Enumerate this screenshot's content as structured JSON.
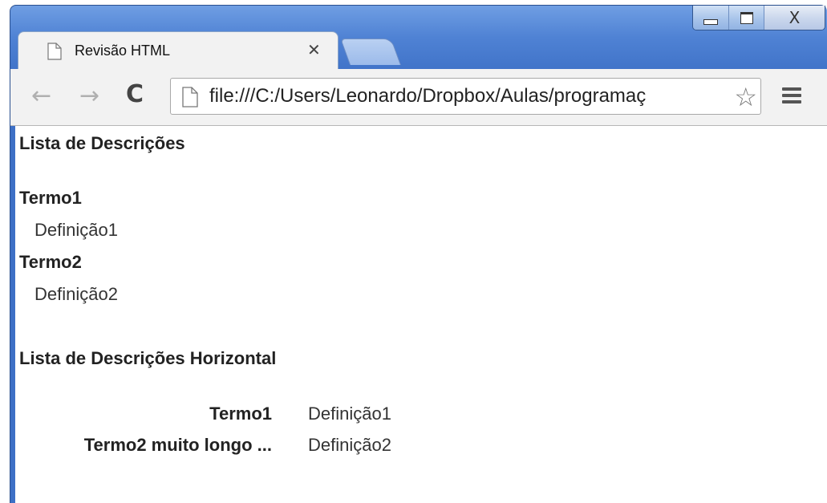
{
  "window": {
    "caption_buttons": [
      "minimize-icon",
      "maximize-icon",
      "close-icon"
    ]
  },
  "tab": {
    "title": "Revisão HTML",
    "close_glyph": "✕",
    "icon": "page-icon"
  },
  "toolbar": {
    "back_glyph": "←",
    "forward_glyph": "→",
    "reload_glyph": "C",
    "url": "file:///C:/Users/Leonardo/Dropbox/Aulas/programaç",
    "star_glyph": "☆"
  },
  "content": {
    "section1_title": "Lista de Descrições",
    "list1": [
      {
        "term": "Termo1",
        "definition": "Definição1"
      },
      {
        "term": "Termo2",
        "definition": "Definição2"
      }
    ],
    "section2_title": "Lista de Descrições Horizontal",
    "list2": [
      {
        "term": "Termo1",
        "definition": "Definição1"
      },
      {
        "term": "Termo2 muito longo ...",
        "definition": "Definição2"
      }
    ]
  },
  "colors": {
    "frame": "#4f82d4",
    "toolbar": "#f2f2f2",
    "page": "#ffffff"
  }
}
